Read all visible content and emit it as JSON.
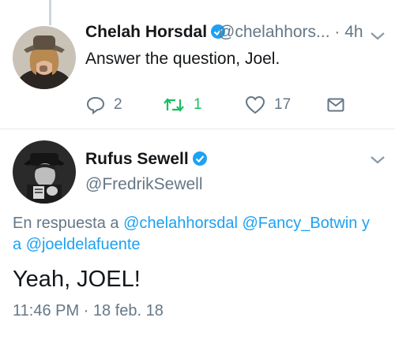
{
  "reply_tweet": {
    "name": "Chelah Horsdal",
    "handle": "@chelahhors...",
    "separator": "·",
    "time": "4h",
    "text": "Answer the question, Joel.",
    "actions": {
      "reply_count": "2",
      "retweet_count": "1",
      "like_count": "17"
    }
  },
  "main_tweet": {
    "name": "Rufus Sewell",
    "handle": "@FredrikSewell",
    "reply_prefix": "En respuesta a",
    "mentions": [
      "@chelahhorsdal",
      "@Fancy_Botwin"
    ],
    "reply_joiner": "y",
    "reply_joiner_a": "a",
    "mention_last": "@joeldelafuente",
    "text": "Yeah, JOEL!",
    "timestamp": "11:46 PM · 18 feb. 18"
  },
  "colors": {
    "verified": "#1da1f2",
    "retweet": "#17bf63",
    "muted": "#657786",
    "link": "#1da1f2"
  }
}
